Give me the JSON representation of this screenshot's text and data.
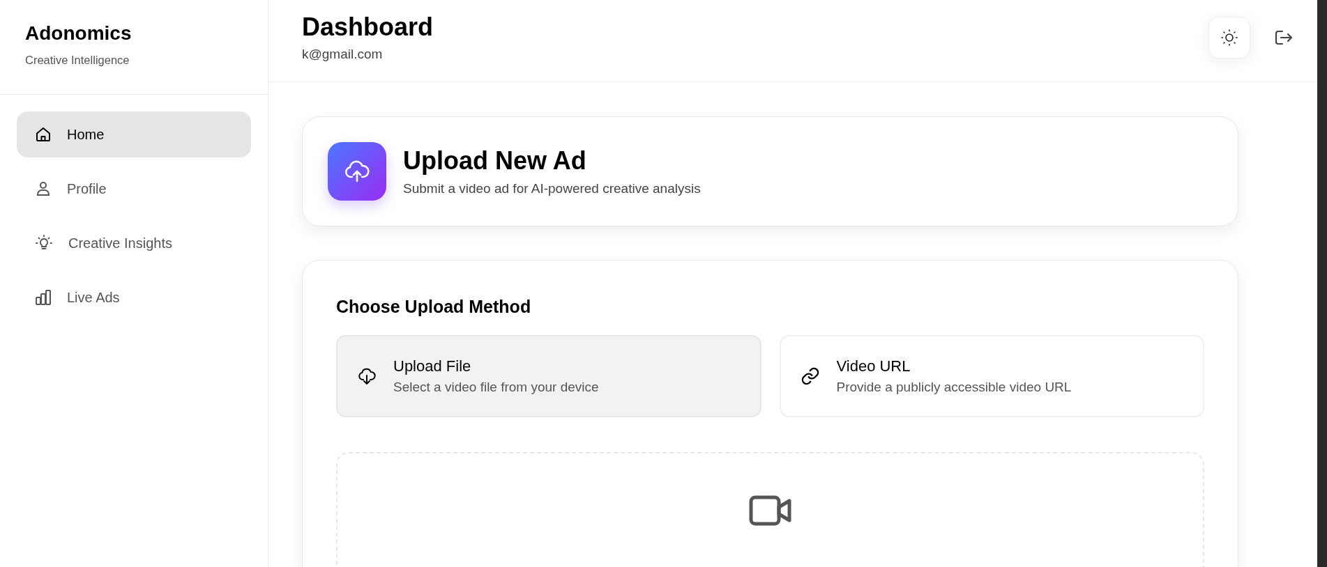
{
  "sidebar": {
    "brand": "Adonomics",
    "tagline": "Creative Intelligence",
    "items": [
      {
        "label": "Home",
        "kind": "home",
        "selected": true
      },
      {
        "label": "Profile",
        "kind": "profile",
        "selected": false
      },
      {
        "label": "Creative Insights",
        "kind": "insights",
        "selected": false
      },
      {
        "label": "Live Ads",
        "kind": "ads",
        "selected": false
      }
    ]
  },
  "header": {
    "title": "Dashboard",
    "email": "k@gmail.com"
  },
  "upload_card": {
    "title": "Upload New Ad",
    "subtitle": "Submit a video ad for AI-powered creative analysis"
  },
  "method_section": {
    "heading": "Choose Upload Method",
    "methods": [
      {
        "kind": "file",
        "title": "Upload File",
        "description": "Select a video file from your device",
        "selected": true
      },
      {
        "kind": "url",
        "title": "Video URL",
        "description": "Provide a publicly accessible video URL",
        "selected": false
      }
    ]
  }
}
